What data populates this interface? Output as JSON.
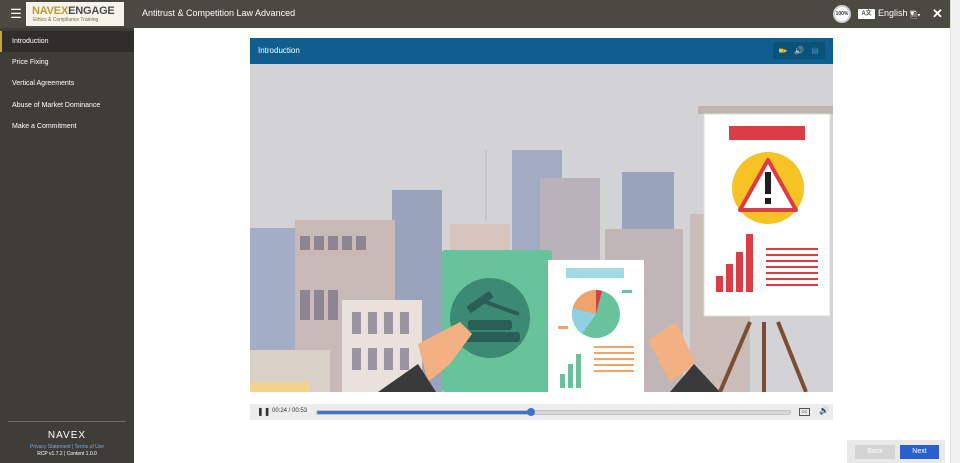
{
  "header": {
    "logo_navex": "NAVEX",
    "logo_engage": "ENGAGE",
    "logo_tagline": "Ethics & Compliance Training",
    "course_title": "Antitrust & Competition Law Advanced",
    "progress_badge": "100%",
    "language_icon_text": "A文",
    "language": "English"
  },
  "sidebar": {
    "items": [
      {
        "label": "Introduction",
        "active": true
      },
      {
        "label": "Price Fixing"
      },
      {
        "label": "Vertical Agreements"
      },
      {
        "label": "Abuse of Market Dominance"
      },
      {
        "label": "Make a Commitment"
      }
    ],
    "brand": "NAVEX",
    "links": "Privacy Statement | Terms of Use",
    "version": "RCP v1.7.2 | Content 1.0.0"
  },
  "player": {
    "title": "Introduction",
    "media_tabs": [
      "video-camera-icon",
      "audio-icon",
      "transcript-icon"
    ],
    "time": "00:24 / 00:53",
    "progress_fraction": 0.4528,
    "cc_label": "CC"
  },
  "colors": {
    "topbar": "#4b4a40",
    "sidebar": "#3f3d38",
    "player_header": "#0e5f8d",
    "accent_blue": "#3f74c9",
    "next_button": "#2b5fd0",
    "warning_red": "#dc3c43",
    "warning_yellow": "#f6c324"
  },
  "footer": {
    "back_label": "Back",
    "next_label": "Next"
  }
}
